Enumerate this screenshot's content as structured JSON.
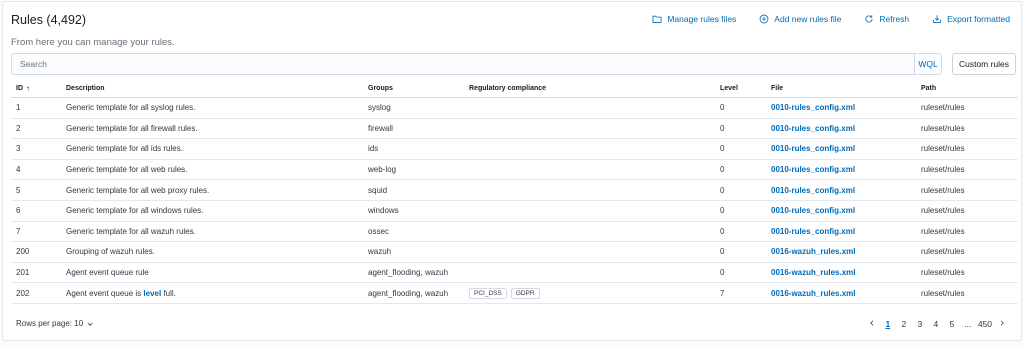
{
  "header": {
    "title": "Rules (4,492)",
    "subtitle": "From here you can manage your rules.",
    "actions": [
      {
        "label": "Manage rules files",
        "icon": "folder-icon"
      },
      {
        "label": "Add new rules file",
        "icon": "plus-circle-icon"
      },
      {
        "label": "Refresh",
        "icon": "refresh-icon"
      },
      {
        "label": "Export formatted",
        "icon": "export-icon"
      }
    ]
  },
  "search": {
    "placeholder": "Search",
    "value": "",
    "wql_label": "WQL"
  },
  "custom_rules_label": "Custom rules",
  "table": {
    "columns": [
      "ID",
      "Description",
      "Groups",
      "Regulatory compliance",
      "Level",
      "File",
      "Path"
    ],
    "rows": [
      {
        "id": "1",
        "desc_pre": "Generic template for all syslog rules.",
        "desc_hl": "",
        "desc_post": "",
        "groups": "syslog",
        "compliance": [],
        "level": "0",
        "file": "0010-rules_config.xml",
        "path": "ruleset/rules"
      },
      {
        "id": "2",
        "desc_pre": "Generic template for all firewall rules.",
        "desc_hl": "",
        "desc_post": "",
        "groups": "firewall",
        "compliance": [],
        "level": "0",
        "file": "0010-rules_config.xml",
        "path": "ruleset/rules"
      },
      {
        "id": "3",
        "desc_pre": "Generic template for all ids rules.",
        "desc_hl": "",
        "desc_post": "",
        "groups": "ids",
        "compliance": [],
        "level": "0",
        "file": "0010-rules_config.xml",
        "path": "ruleset/rules"
      },
      {
        "id": "4",
        "desc_pre": "Generic template for all web rules.",
        "desc_hl": "",
        "desc_post": "",
        "groups": "web-log",
        "compliance": [],
        "level": "0",
        "file": "0010-rules_config.xml",
        "path": "ruleset/rules"
      },
      {
        "id": "5",
        "desc_pre": "Generic template for all web proxy rules.",
        "desc_hl": "",
        "desc_post": "",
        "groups": "squid",
        "compliance": [],
        "level": "0",
        "file": "0010-rules_config.xml",
        "path": "ruleset/rules"
      },
      {
        "id": "6",
        "desc_pre": "Generic template for all windows rules.",
        "desc_hl": "",
        "desc_post": "",
        "groups": "windows",
        "compliance": [],
        "level": "0",
        "file": "0010-rules_config.xml",
        "path": "ruleset/rules"
      },
      {
        "id": "7",
        "desc_pre": "Generic template for all wazuh rules.",
        "desc_hl": "",
        "desc_post": "",
        "groups": "ossec",
        "compliance": [],
        "level": "0",
        "file": "0010-rules_config.xml",
        "path": "ruleset/rules"
      },
      {
        "id": "200",
        "desc_pre": "Grouping of wazuh rules.",
        "desc_hl": "",
        "desc_post": "",
        "groups": "wazuh",
        "compliance": [],
        "level": "0",
        "file": "0016-wazuh_rules.xml",
        "path": "ruleset/rules"
      },
      {
        "id": "201",
        "desc_pre": "Agent event queue rule",
        "desc_hl": "",
        "desc_post": "",
        "groups": "agent_flooding, wazuh",
        "compliance": [],
        "level": "0",
        "file": "0016-wazuh_rules.xml",
        "path": "ruleset/rules"
      },
      {
        "id": "202",
        "desc_pre": "Agent event queue is ",
        "desc_hl": "level",
        "desc_post": " full.",
        "groups": "agent_flooding, wazuh",
        "compliance": [
          "PCI_DSS",
          "GDPR"
        ],
        "level": "7",
        "file": "0016-wazuh_rules.xml",
        "path": "ruleset/rules"
      }
    ]
  },
  "footer": {
    "rows_per_page": "Rows per page: 10",
    "pages": [
      "1",
      "2",
      "3",
      "4",
      "5",
      "...",
      "450"
    ],
    "current_page": "1"
  },
  "colors": {
    "link": "#006bb8",
    "border": "#e3e7ef",
    "text": "#343741"
  }
}
